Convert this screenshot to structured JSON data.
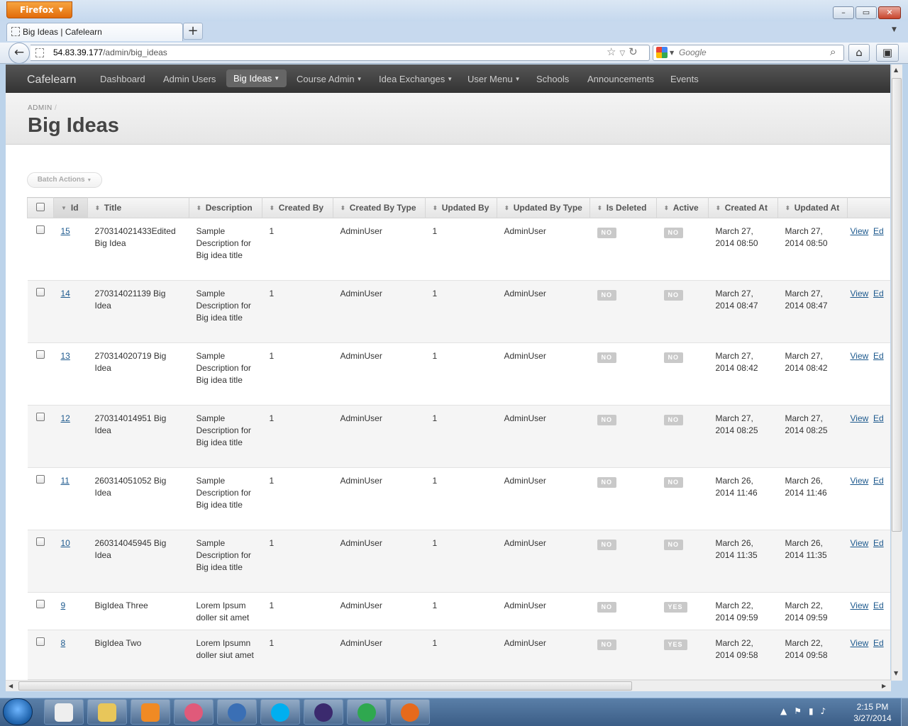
{
  "browser": {
    "menu_label": "Firefox",
    "tab_title": "Big Ideas | Cafelearn",
    "url_host": "54.83.39.177",
    "url_path": "/admin/big_ideas",
    "search_placeholder": "Google"
  },
  "app": {
    "brand": "Cafelearn",
    "nav": [
      {
        "label": "Dashboard"
      },
      {
        "label": "Admin Users"
      },
      {
        "label": "Big Ideas"
      },
      {
        "label": "Course Admin"
      },
      {
        "label": "Idea Exchanges"
      },
      {
        "label": "User Menu"
      },
      {
        "label": "Schools"
      },
      {
        "label": "Announcements"
      },
      {
        "label": "Events"
      }
    ],
    "breadcrumb": "ADMIN",
    "breadcrumb_sep": "/",
    "page_title": "Big Ideas",
    "batch_actions": "Batch Actions"
  },
  "table": {
    "columns": [
      "Id",
      "Title",
      "Description",
      "Created By",
      "Created By Type",
      "Updated By",
      "Updated By Type",
      "Is Deleted",
      "Active",
      "Created At",
      "Updated At"
    ],
    "view_label": "View",
    "edit_label": "Ed",
    "rows": [
      {
        "id": "15",
        "title": "270314021433Edited Big Idea",
        "description": "Sample Description for Big idea title",
        "created_by": "1",
        "created_by_type": "AdminUser",
        "updated_by": "1",
        "updated_by_type": "AdminUser",
        "is_deleted": "NO",
        "active": "NO",
        "created_at": "March 27, 2014 08:50",
        "updated_at": "March 27, 2014 08:50"
      },
      {
        "id": "14",
        "title": "270314021139 Big Idea",
        "description": "Sample Description for Big idea title",
        "created_by": "1",
        "created_by_type": "AdminUser",
        "updated_by": "1",
        "updated_by_type": "AdminUser",
        "is_deleted": "NO",
        "active": "NO",
        "created_at": "March 27, 2014 08:47",
        "updated_at": "March 27, 2014 08:47"
      },
      {
        "id": "13",
        "title": "270314020719 Big Idea",
        "description": "Sample Description for Big idea title",
        "created_by": "1",
        "created_by_type": "AdminUser",
        "updated_by": "1",
        "updated_by_type": "AdminUser",
        "is_deleted": "NO",
        "active": "NO",
        "created_at": "March 27, 2014 08:42",
        "updated_at": "March 27, 2014 08:42"
      },
      {
        "id": "12",
        "title": "270314014951 Big Idea",
        "description": "Sample Description for Big idea title",
        "created_by": "1",
        "created_by_type": "AdminUser",
        "updated_by": "1",
        "updated_by_type": "AdminUser",
        "is_deleted": "NO",
        "active": "NO",
        "created_at": "March 27, 2014 08:25",
        "updated_at": "March 27, 2014 08:25"
      },
      {
        "id": "11",
        "title": "260314051052 Big Idea",
        "description": "Sample Description for Big idea title",
        "created_by": "1",
        "created_by_type": "AdminUser",
        "updated_by": "1",
        "updated_by_type": "AdminUser",
        "is_deleted": "NO",
        "active": "NO",
        "created_at": "March 26, 2014 11:46",
        "updated_at": "March 26, 2014 11:46"
      },
      {
        "id": "10",
        "title": "260314045945 Big Idea",
        "description": "Sample Description for Big idea title",
        "created_by": "1",
        "created_by_type": "AdminUser",
        "updated_by": "1",
        "updated_by_type": "AdminUser",
        "is_deleted": "NO",
        "active": "NO",
        "created_at": "March 26, 2014 11:35",
        "updated_at": "March 26, 2014 11:35"
      },
      {
        "id": "9",
        "title": "BigIdea Three",
        "description": "Lorem Ipsum doller sit amet",
        "created_by": "1",
        "created_by_type": "AdminUser",
        "updated_by": "1",
        "updated_by_type": "AdminUser",
        "is_deleted": "NO",
        "active": "YES",
        "created_at": "March 22, 2014 09:59",
        "updated_at": "March 22, 2014 09:59"
      },
      {
        "id": "8",
        "title": "BigIdea Two",
        "description": "Lorem Ipsumn doller siut amet",
        "created_by": "1",
        "created_by_type": "AdminUser",
        "updated_by": "1",
        "updated_by_type": "AdminUser",
        "is_deleted": "NO",
        "active": "YES",
        "created_at": "March 22, 2014 09:58",
        "updated_at": "March 22, 2014 09:58"
      }
    ]
  },
  "taskbar": {
    "time": "2:15 PM",
    "date": "3/27/2014",
    "apps": [
      "notepad-icon",
      "explorer-icon",
      "media-player-icon",
      "picasa-icon",
      "thunderbird-icon",
      "skype-icon",
      "eclipse-icon",
      "chrome-icon",
      "firefox-icon"
    ],
    "app_colors": [
      "#eeeeee",
      "#e8c65a",
      "#f08a24",
      "#e05a7a",
      "#3a6fb5",
      "#00aff0",
      "#3b2a6e",
      "#2fa84f",
      "#e66a1c"
    ]
  }
}
